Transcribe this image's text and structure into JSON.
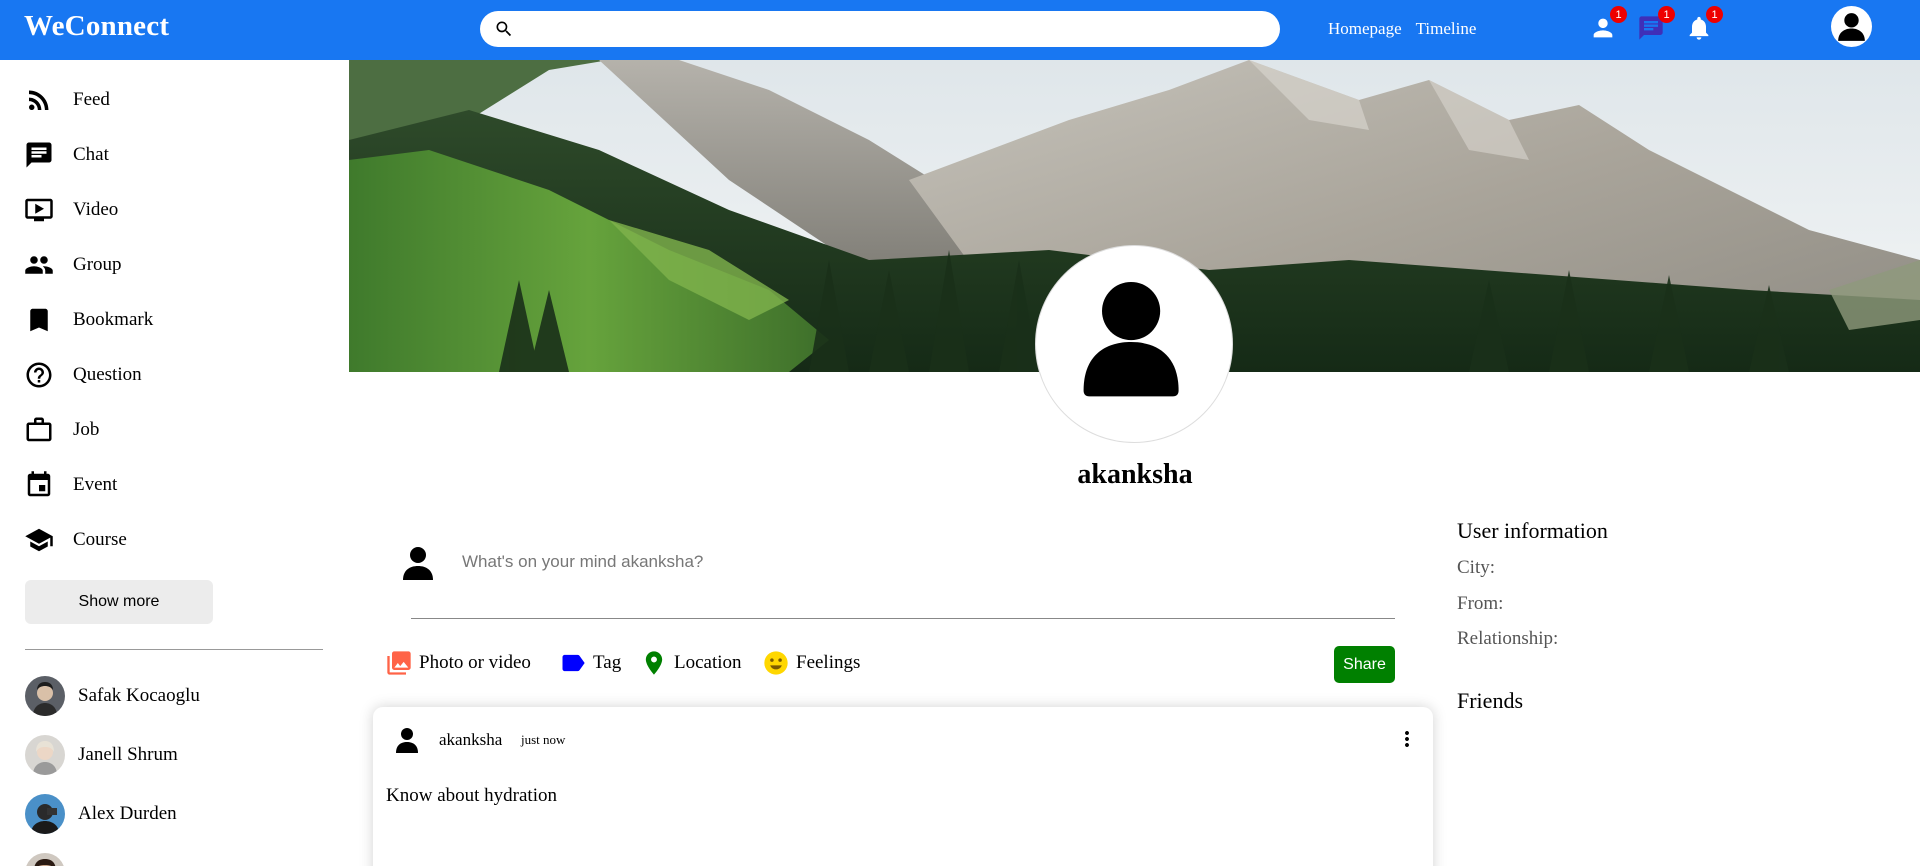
{
  "app": {
    "name": "WeConnect"
  },
  "search": {
    "placeholder": ""
  },
  "topbar": {
    "links": [
      "Homepage",
      "Timeline"
    ],
    "notifications": {
      "friends": "1",
      "messages": "1",
      "alerts": "1"
    }
  },
  "sidebar": {
    "items": [
      {
        "label": "Feed",
        "icon": "rss-feed-icon"
      },
      {
        "label": "Chat",
        "icon": "chat-icon"
      },
      {
        "label": "Video",
        "icon": "play-circle-icon"
      },
      {
        "label": "Group",
        "icon": "group-icon"
      },
      {
        "label": "Bookmark",
        "icon": "bookmark-icon"
      },
      {
        "label": "Question",
        "icon": "help-icon"
      },
      {
        "label": "Job",
        "icon": "work-icon"
      },
      {
        "label": "Event",
        "icon": "event-icon"
      },
      {
        "label": "Course",
        "icon": "school-icon"
      }
    ],
    "show_more": "Show more",
    "friends": [
      "Safak Kocaoglu",
      "Janell Shrum",
      "Alex Durden"
    ]
  },
  "profile": {
    "name": "akanksha"
  },
  "share": {
    "placeholder": "What's on your mind akanksha?",
    "options": [
      "Photo or video",
      "Tag",
      "Location",
      "Feelings"
    ],
    "button": "Share"
  },
  "post": {
    "username": "akanksha",
    "date": "just now",
    "text": "Know about hydration"
  },
  "rightbar": {
    "title": "User information",
    "fields": [
      "City:",
      "From:",
      "Relationship:"
    ],
    "friends_title": "Friends"
  },
  "colors": {
    "topbar": "#1877f2",
    "badge": "#ff0000",
    "share_button": "#008000",
    "photo_icon": "#ff6347",
    "tag_icon": "#0000ff",
    "location_icon": "#008000",
    "feelings_icon": "#ffd700"
  }
}
